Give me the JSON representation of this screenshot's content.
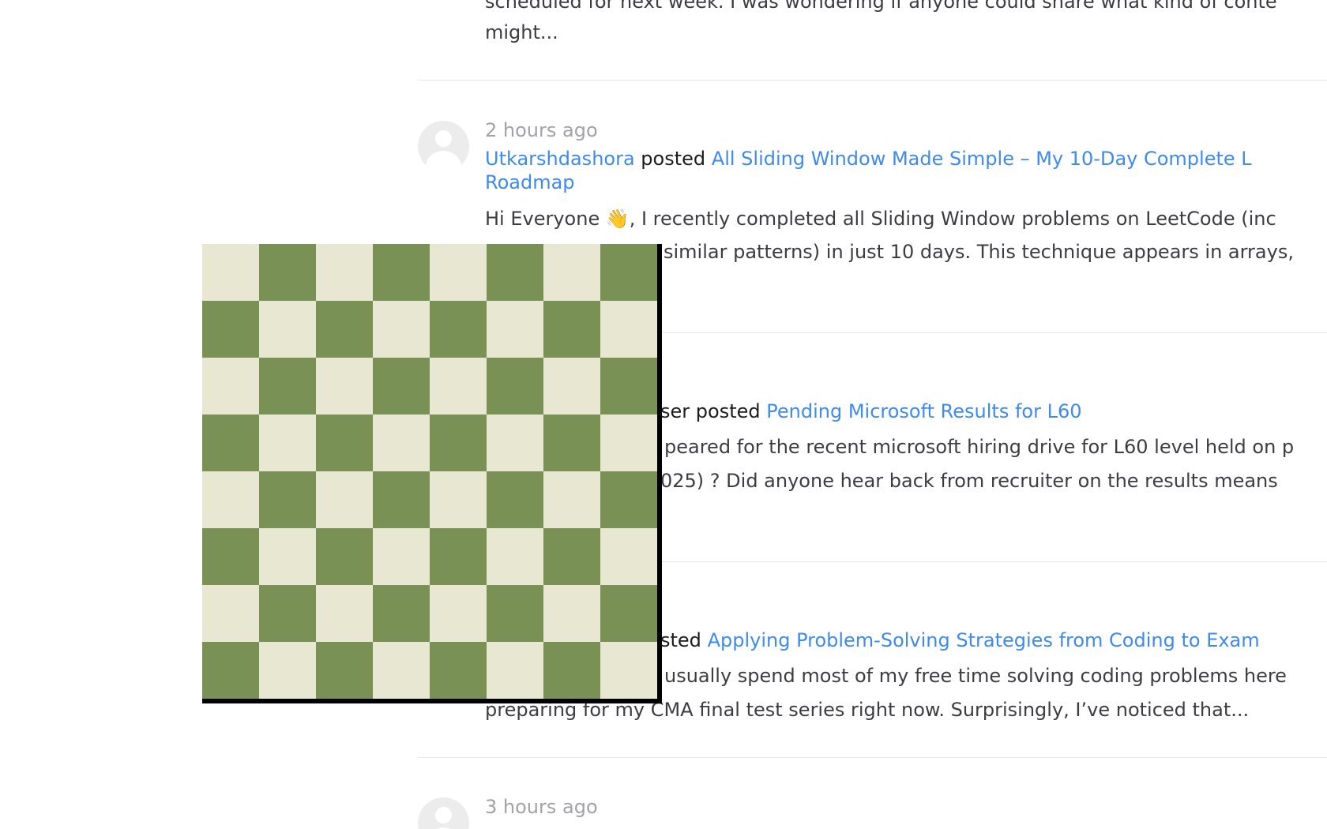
{
  "feed": {
    "posts": [
      {
        "lines": [
          "scheduled for next week. I was wondering if anyone could share what kind of conte",
          "might..."
        ]
      },
      {
        "time": "2 hours ago",
        "author": "Utkarshdashora",
        "verb": "posted",
        "title_part1": "All Sliding Window Made Simple – My 10-Day Complete L",
        "title_part2": "Roadmap",
        "lines": [
          "Hi Everyone 👋, I recently completed all Sliding Window problems on LeetCode (inc",
          "similar patterns) in just 10 days. This technique appears in arrays,"
        ]
      },
      {
        "author_fragment": "ser",
        "verb": "posted",
        "title": "Pending Microsoft Results for L60",
        "lines": [
          "peared for the recent microsoft hiring drive for L60 level held on p",
          "025) ? Did anyone hear back from recruiter on the results means"
        ]
      },
      {
        "verb_fragment": "sted",
        "title": "Applying Problem-Solving Strategies from Coding to Exam",
        "lines": [
          "usually spend most of my free time solving coding problems here",
          "preparing for my CMA final test series right now. Surprisingly, I’ve noticed that..."
        ]
      },
      {
        "time": "3 hours ago"
      }
    ]
  },
  "chessboard": {
    "light_color": "#e8e7d1",
    "dark_color": "#7a9156",
    "border_color": "#000000",
    "size": 8
  }
}
